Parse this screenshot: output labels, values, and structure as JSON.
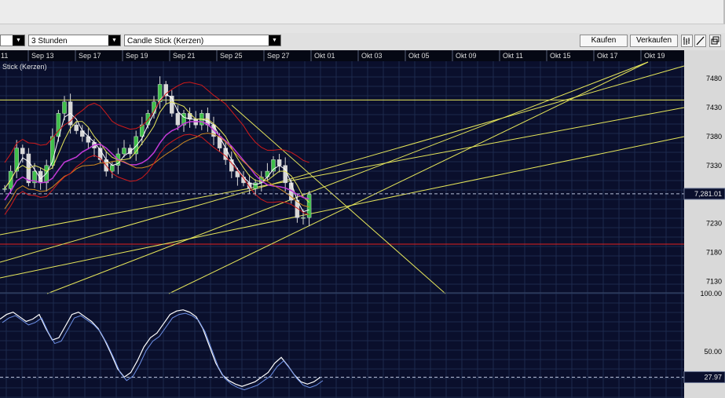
{
  "toolbar": {
    "leftbox_value": "",
    "interval_value": "3 Stunden",
    "charttype_value": "Candle Stick (Kerzen)",
    "buy_label": "Kaufen",
    "sell_label": "Verkaufen"
  },
  "chart_data": {
    "type": "candlestick",
    "legend_text": "Stick (Kerzen)",
    "x_ticks": [
      "11",
      "Sep 13",
      "Sep 17",
      "Sep 19",
      "Sep 21",
      "Sep 25",
      "Sep 27",
      "Okt 01",
      "Okt 03",
      "Okt 05",
      "Okt 09",
      "Okt 11",
      "Okt 15",
      "Okt 17",
      "Okt 19"
    ],
    "price_ticks": [
      7480,
      7430,
      7380,
      7330,
      7280,
      7230,
      7180,
      7130
    ],
    "price_ylim": [
      7110,
      7510
    ],
    "price_marker": "7,281.01",
    "price_marker_value": 7281.01,
    "horizontal_lines": [
      {
        "value": 7443,
        "color": "#e8e85a"
      },
      {
        "value": 7194,
        "color": "#e02020"
      }
    ],
    "close_series": [
      7290,
      7320,
      7360,
      7350,
      7300,
      7320,
      7300,
      7330,
      7380,
      7420,
      7440,
      7400,
      7390,
      7380,
      7370,
      7360,
      7340,
      7320,
      7330,
      7350,
      7360,
      7350,
      7380,
      7400,
      7420,
      7440,
      7470,
      7450,
      7420,
      7400,
      7420,
      7410,
      7400,
      7420,
      7400,
      7380,
      7360,
      7340,
      7320,
      7310,
      7300,
      7290,
      7300,
      7310,
      7320,
      7340,
      7330,
      7300,
      7270,
      7240,
      7240,
      7280
    ],
    "oscillator": {
      "ticks": [
        "100.00",
        "50.00"
      ],
      "ylim": [
        10,
        100
      ],
      "marker": "27.97",
      "marker_value": 27.97,
      "series": [
        78,
        82,
        84,
        80,
        76,
        78,
        82,
        70,
        60,
        62,
        72,
        82,
        84,
        80,
        76,
        70,
        60,
        48,
        35,
        28,
        32,
        42,
        54,
        62,
        66,
        74,
        82,
        85,
        86,
        84,
        80,
        70,
        55,
        40,
        30,
        25,
        22,
        20,
        22,
        24,
        28,
        32,
        40,
        45,
        38,
        30,
        24,
        22,
        24,
        27.97
      ]
    }
  }
}
